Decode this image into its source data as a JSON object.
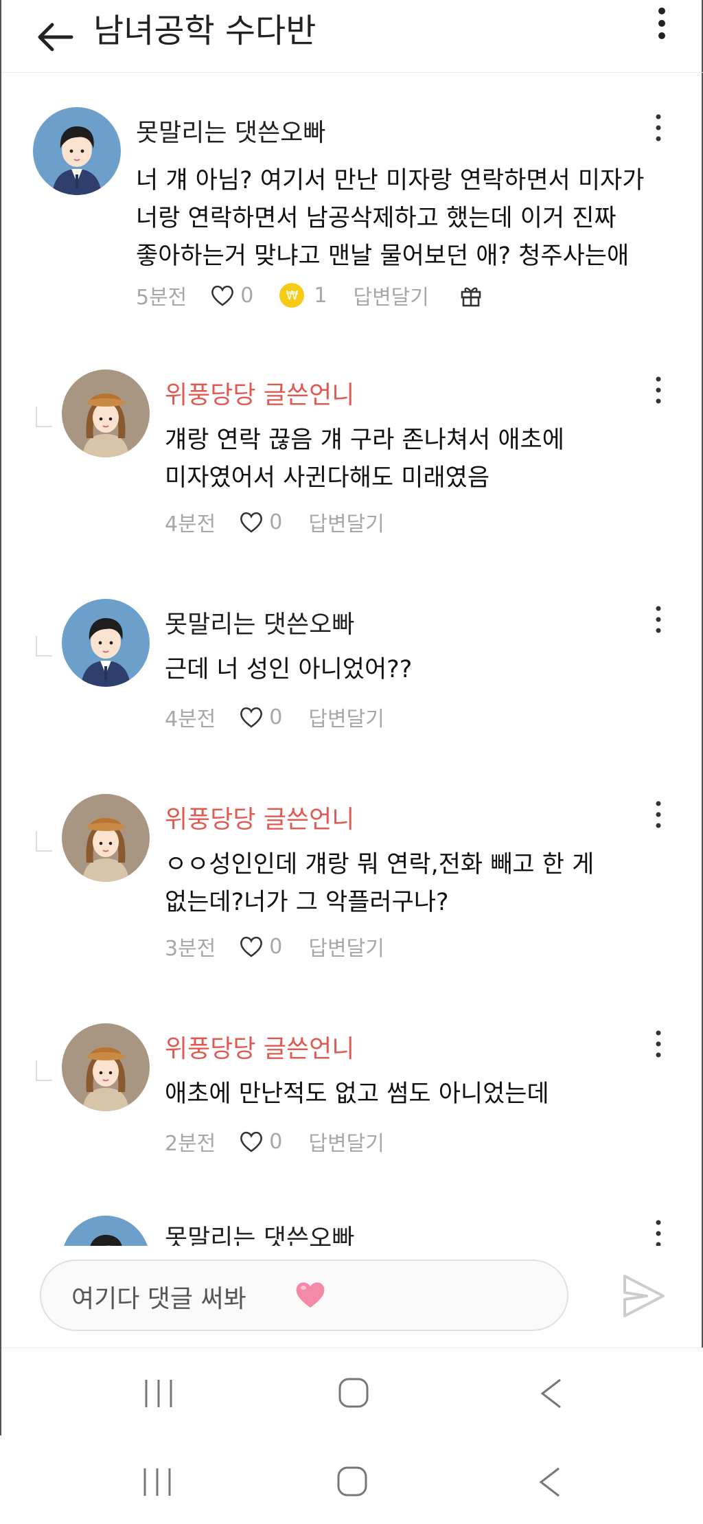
{
  "header": {
    "title": "남녀공학 수다반"
  },
  "comments": [
    {
      "author": "못말리는 댓쓴오빠",
      "author_color": "#222222",
      "avatar": "boy-avatar",
      "lines": [
        "너 걔 아님? 여기서 만난 미자랑 연락하면서 미자가",
        "너랑 연락하면서 남공삭제하고 했는데 이거 진짜",
        "좋아하는거 맞냐고 맨날 물어보던 애? 청주사는애"
      ],
      "time": "5분전",
      "likes": "0",
      "coins": "1",
      "reply_label": "답변달기"
    },
    {
      "author": "위풍당당 글쓴언니",
      "author_color": "#e05a52",
      "avatar": "girl-avatar",
      "lines": [
        "걔랑 연락 끊음 걔 구라 존나쳐서 애초에",
        "미자였어서 사귄다해도 미래였음"
      ],
      "time": "4분전",
      "likes": "0",
      "reply_label": "답변달기"
    },
    {
      "author": "못말리는 댓쓴오빠",
      "author_color": "#222222",
      "avatar": "boy-avatar",
      "lines": [
        "근데 너 성인 아니었어??"
      ],
      "time": "4분전",
      "likes": "0",
      "reply_label": "답변달기"
    },
    {
      "author": "위풍당당 글쓴언니",
      "author_color": "#e05a52",
      "avatar": "girl-avatar",
      "lines": [
        "ㅇㅇ성인인데 걔랑 뭐 연락,전화 빼고 한 게",
        "없는데?너가 그 악플러구나?"
      ],
      "time": "3분전",
      "likes": "0",
      "reply_label": "답변달기"
    },
    {
      "author": "위풍당당 글쓴언니",
      "author_color": "#e05a52",
      "avatar": "girl-avatar",
      "lines": [
        "애초에 만난적도 없고 썸도 아니었는데"
      ],
      "time": "2분전",
      "likes": "0",
      "reply_label": "답변달기"
    },
    {
      "author": "못말리는 댓쓴오빠",
      "author_color": "#222222",
      "avatar": "boy-avatar"
    }
  ],
  "input": {
    "placeholder": "여기다 댓글 써봐"
  },
  "icons": {
    "back": "arrow-left-icon",
    "menu": "more-vertical-icon",
    "like": "heart-outline-icon",
    "coin": "won-coin-icon",
    "gift": "gift-icon",
    "send": "send-icon",
    "emoji": "pink-heart-emoji",
    "nav_recent": "recent-apps-icon",
    "nav_home": "home-icon",
    "nav_back": "back-chevron-icon"
  },
  "colors": {
    "author_highlight": "#e05a52",
    "meta_gray": "#a7a7a7",
    "coin": "#f5cb13",
    "heart_emoji": "#f48aa8"
  }
}
